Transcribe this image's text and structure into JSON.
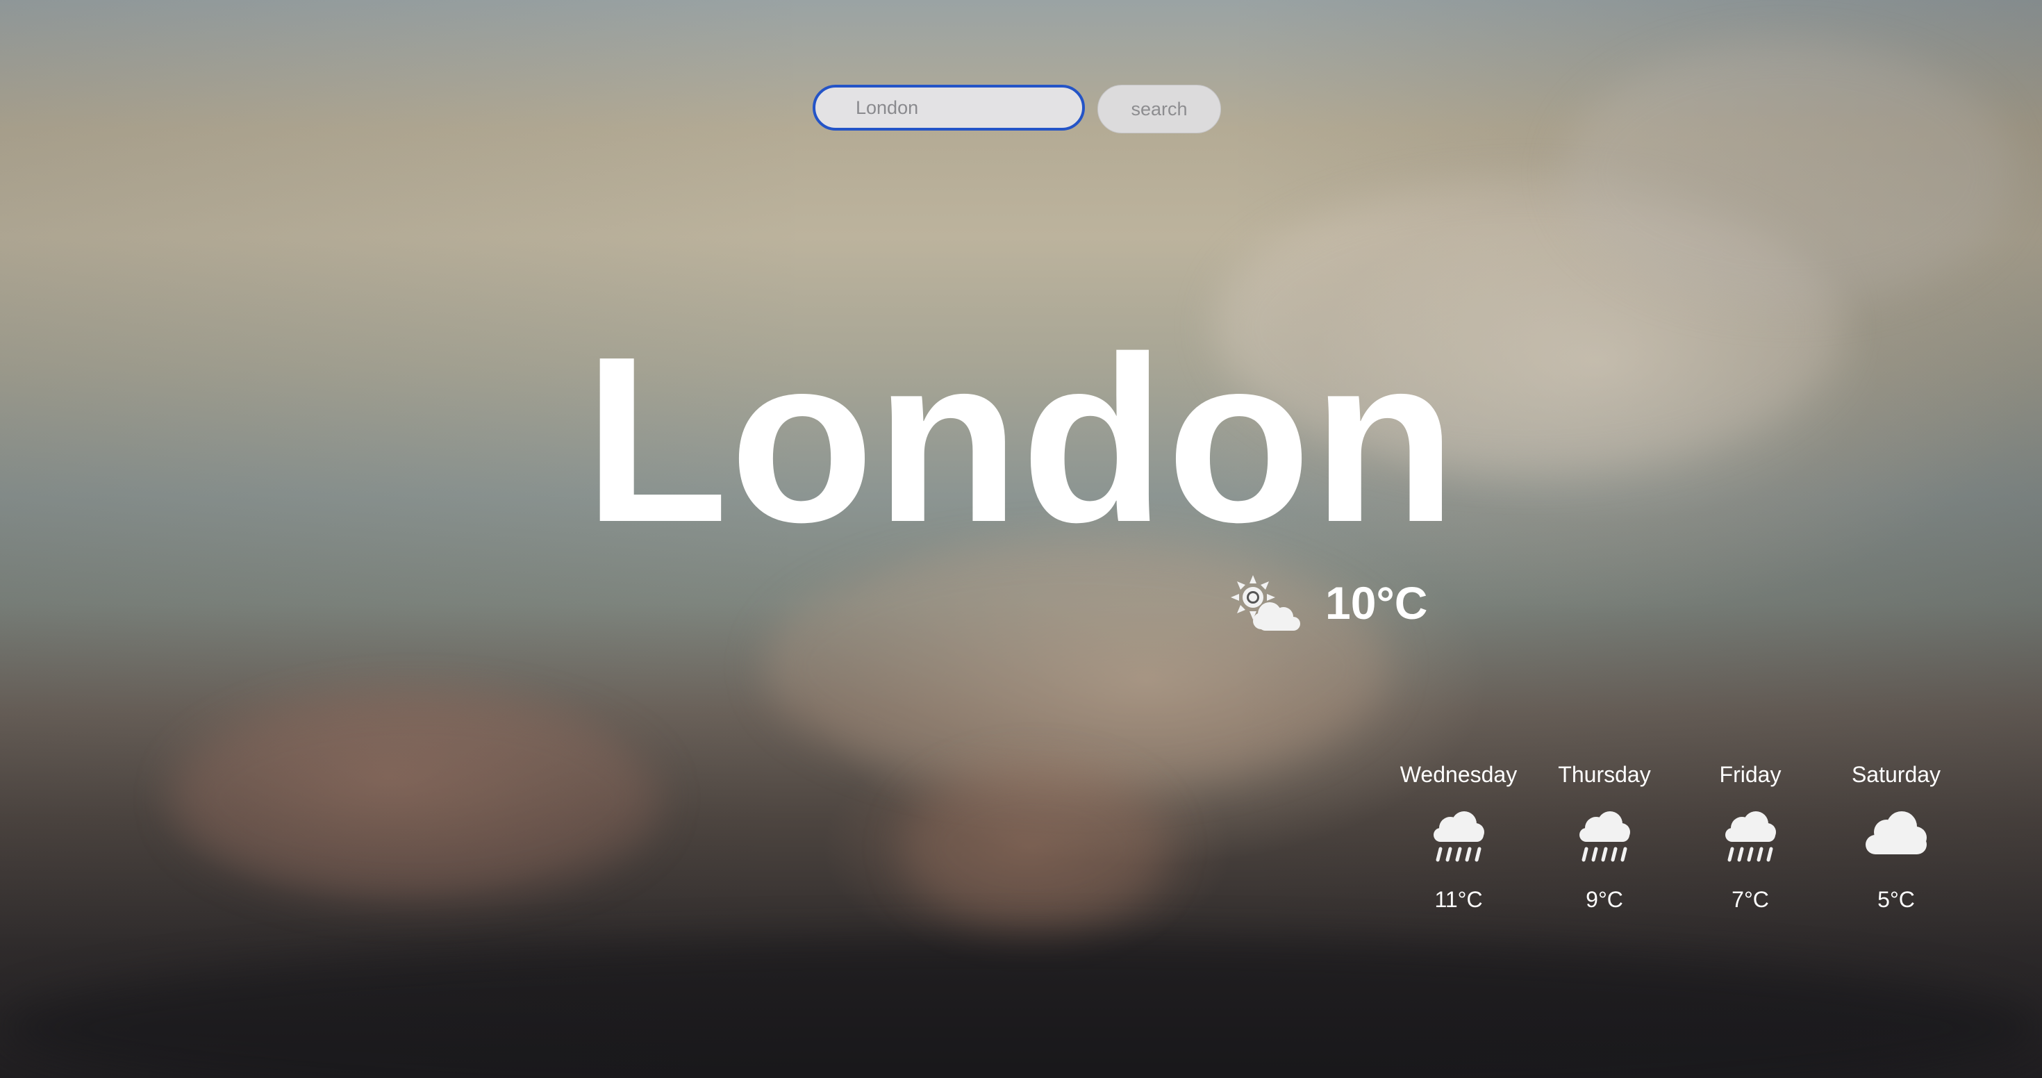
{
  "search": {
    "placeholder": "London",
    "button_label": "search"
  },
  "city": "London",
  "current": {
    "icon": "partly-cloudy-day-icon",
    "temperature": "10°C"
  },
  "forecast": [
    {
      "day": "Wednesday",
      "icon": "rain-icon",
      "temperature": "11°C"
    },
    {
      "day": "Thursday",
      "icon": "rain-icon",
      "temperature": "9°C"
    },
    {
      "day": "Friday",
      "icon": "rain-icon",
      "temperature": "7°C"
    },
    {
      "day": "Saturday",
      "icon": "cloud-icon",
      "temperature": "5°C"
    }
  ],
  "colors": {
    "input_focus_border": "#2454c7",
    "text": "#ffffff"
  }
}
